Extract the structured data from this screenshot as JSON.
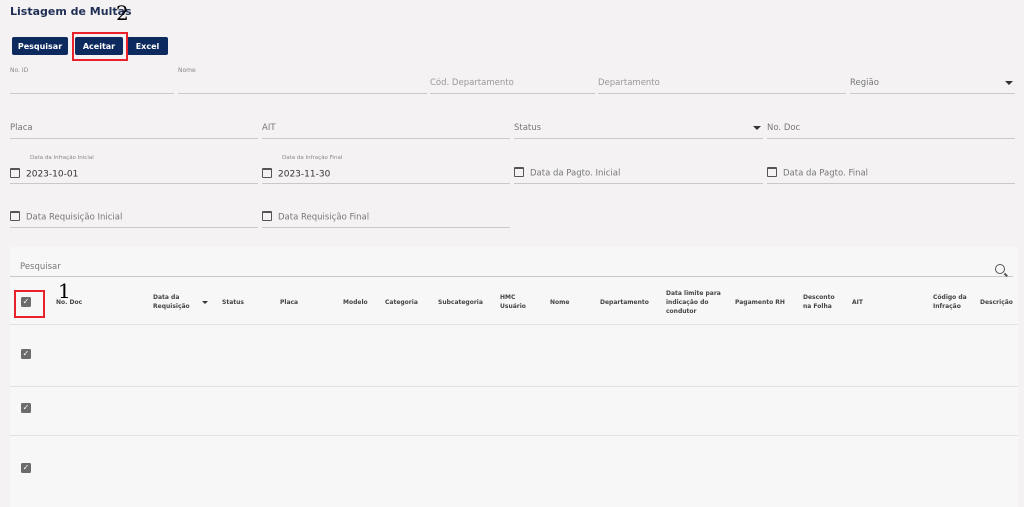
{
  "page": {
    "title": "Listagem de Multas"
  },
  "annotations": {
    "a1": "1",
    "a2": "2"
  },
  "toolbar": {
    "search_label": "Pesquisar",
    "accept_label": "Aceitar",
    "excel_label": "Excel"
  },
  "filters": {
    "no_id": "No. ID",
    "nome": "Nome",
    "cod_departamento": "Cód. Departamento",
    "departamento": "Departamento",
    "regiao": "Região",
    "placa": "Placa",
    "ait": "AIT",
    "status": "Status",
    "no_doc": "No. Doc",
    "data_infracao_inicial_label": "Data da Infração Inicial",
    "data_infracao_inicial_value": "2023-10-01",
    "data_infracao_final_label": "Data da Infração Final",
    "data_infracao_final_value": "2023-11-30",
    "data_pagto_inicial": "Data da Pagto. Inicial",
    "data_pagto_final": "Data da Pagto. Final",
    "data_requisicao_inicial": "Data Requisição Inicial",
    "data_requisicao_final": "Data Requisição Final"
  },
  "table": {
    "search_placeholder": "Pesquisar",
    "columns": {
      "no_doc": "No. Doc",
      "data_requisicao": "Data da Requisição",
      "status": "Status",
      "placa": "Placa",
      "modelo": "Modelo",
      "categoria": "Categoria",
      "subcategoria": "Subcategoria",
      "hmc_usuario": "HMC Usuário",
      "nome": "Nome",
      "departamento": "Departamento",
      "data_limite": "Data limite para indicação do condutor",
      "pagamento_rh": "Pagamento RH",
      "desconto_folha": "Desconto na Folha",
      "ait": "AIT",
      "codigo_infracao": "Código da Infração",
      "descricao": "Descrição"
    },
    "check_mark": "✓"
  },
  "colors": {
    "primary": "#0c2a5e",
    "highlight": "#e8212b"
  }
}
